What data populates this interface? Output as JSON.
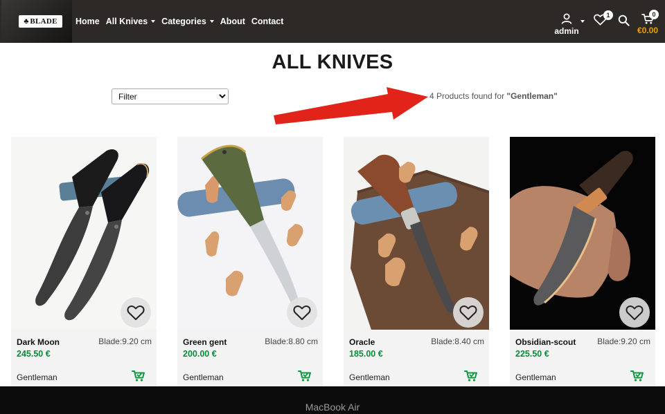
{
  "nav": {
    "logo_text": "BLADE",
    "links": [
      {
        "label": "Home",
        "dropdown": false
      },
      {
        "label": "All Knives",
        "dropdown": true
      },
      {
        "label": "Categories",
        "dropdown": true
      },
      {
        "label": "About",
        "dropdown": false
      },
      {
        "label": "Contact",
        "dropdown": false
      }
    ],
    "user_name": "admin",
    "wishlist_count": "1",
    "cart_count": "0",
    "cart_total": "€0.00",
    "icons": [
      "user-icon",
      "heart-icon",
      "search-icon",
      "cart-icon"
    ],
    "colors": {
      "bar": "#2c2927",
      "cart_total": "#e8a300"
    }
  },
  "page": {
    "title": "ALL KNIVES",
    "filter": {
      "selected": "Filter"
    },
    "results": {
      "count_text": "4 Products found for ",
      "query": "\"Gentleman\""
    },
    "annotation_arrow_color": "#e2231a"
  },
  "products": [
    {
      "name": "Dark Moon",
      "blade": "Blade:9.20 cm",
      "price": "245.50 €",
      "category": "Gentleman"
    },
    {
      "name": "Green gent",
      "blade": "Blade:8.80 cm",
      "price": "200.00 €",
      "category": "Gentleman"
    },
    {
      "name": "Oracle",
      "blade": "Blade:8.40 cm",
      "price": "185.00 €",
      "category": "Gentleman"
    },
    {
      "name": "Obsidian-scout",
      "blade": "Blade:9.20 cm",
      "price": "225.50 €",
      "category": "Gentleman"
    }
  ],
  "price_color": "#0a8a3a",
  "device_label": "MacBook Air"
}
